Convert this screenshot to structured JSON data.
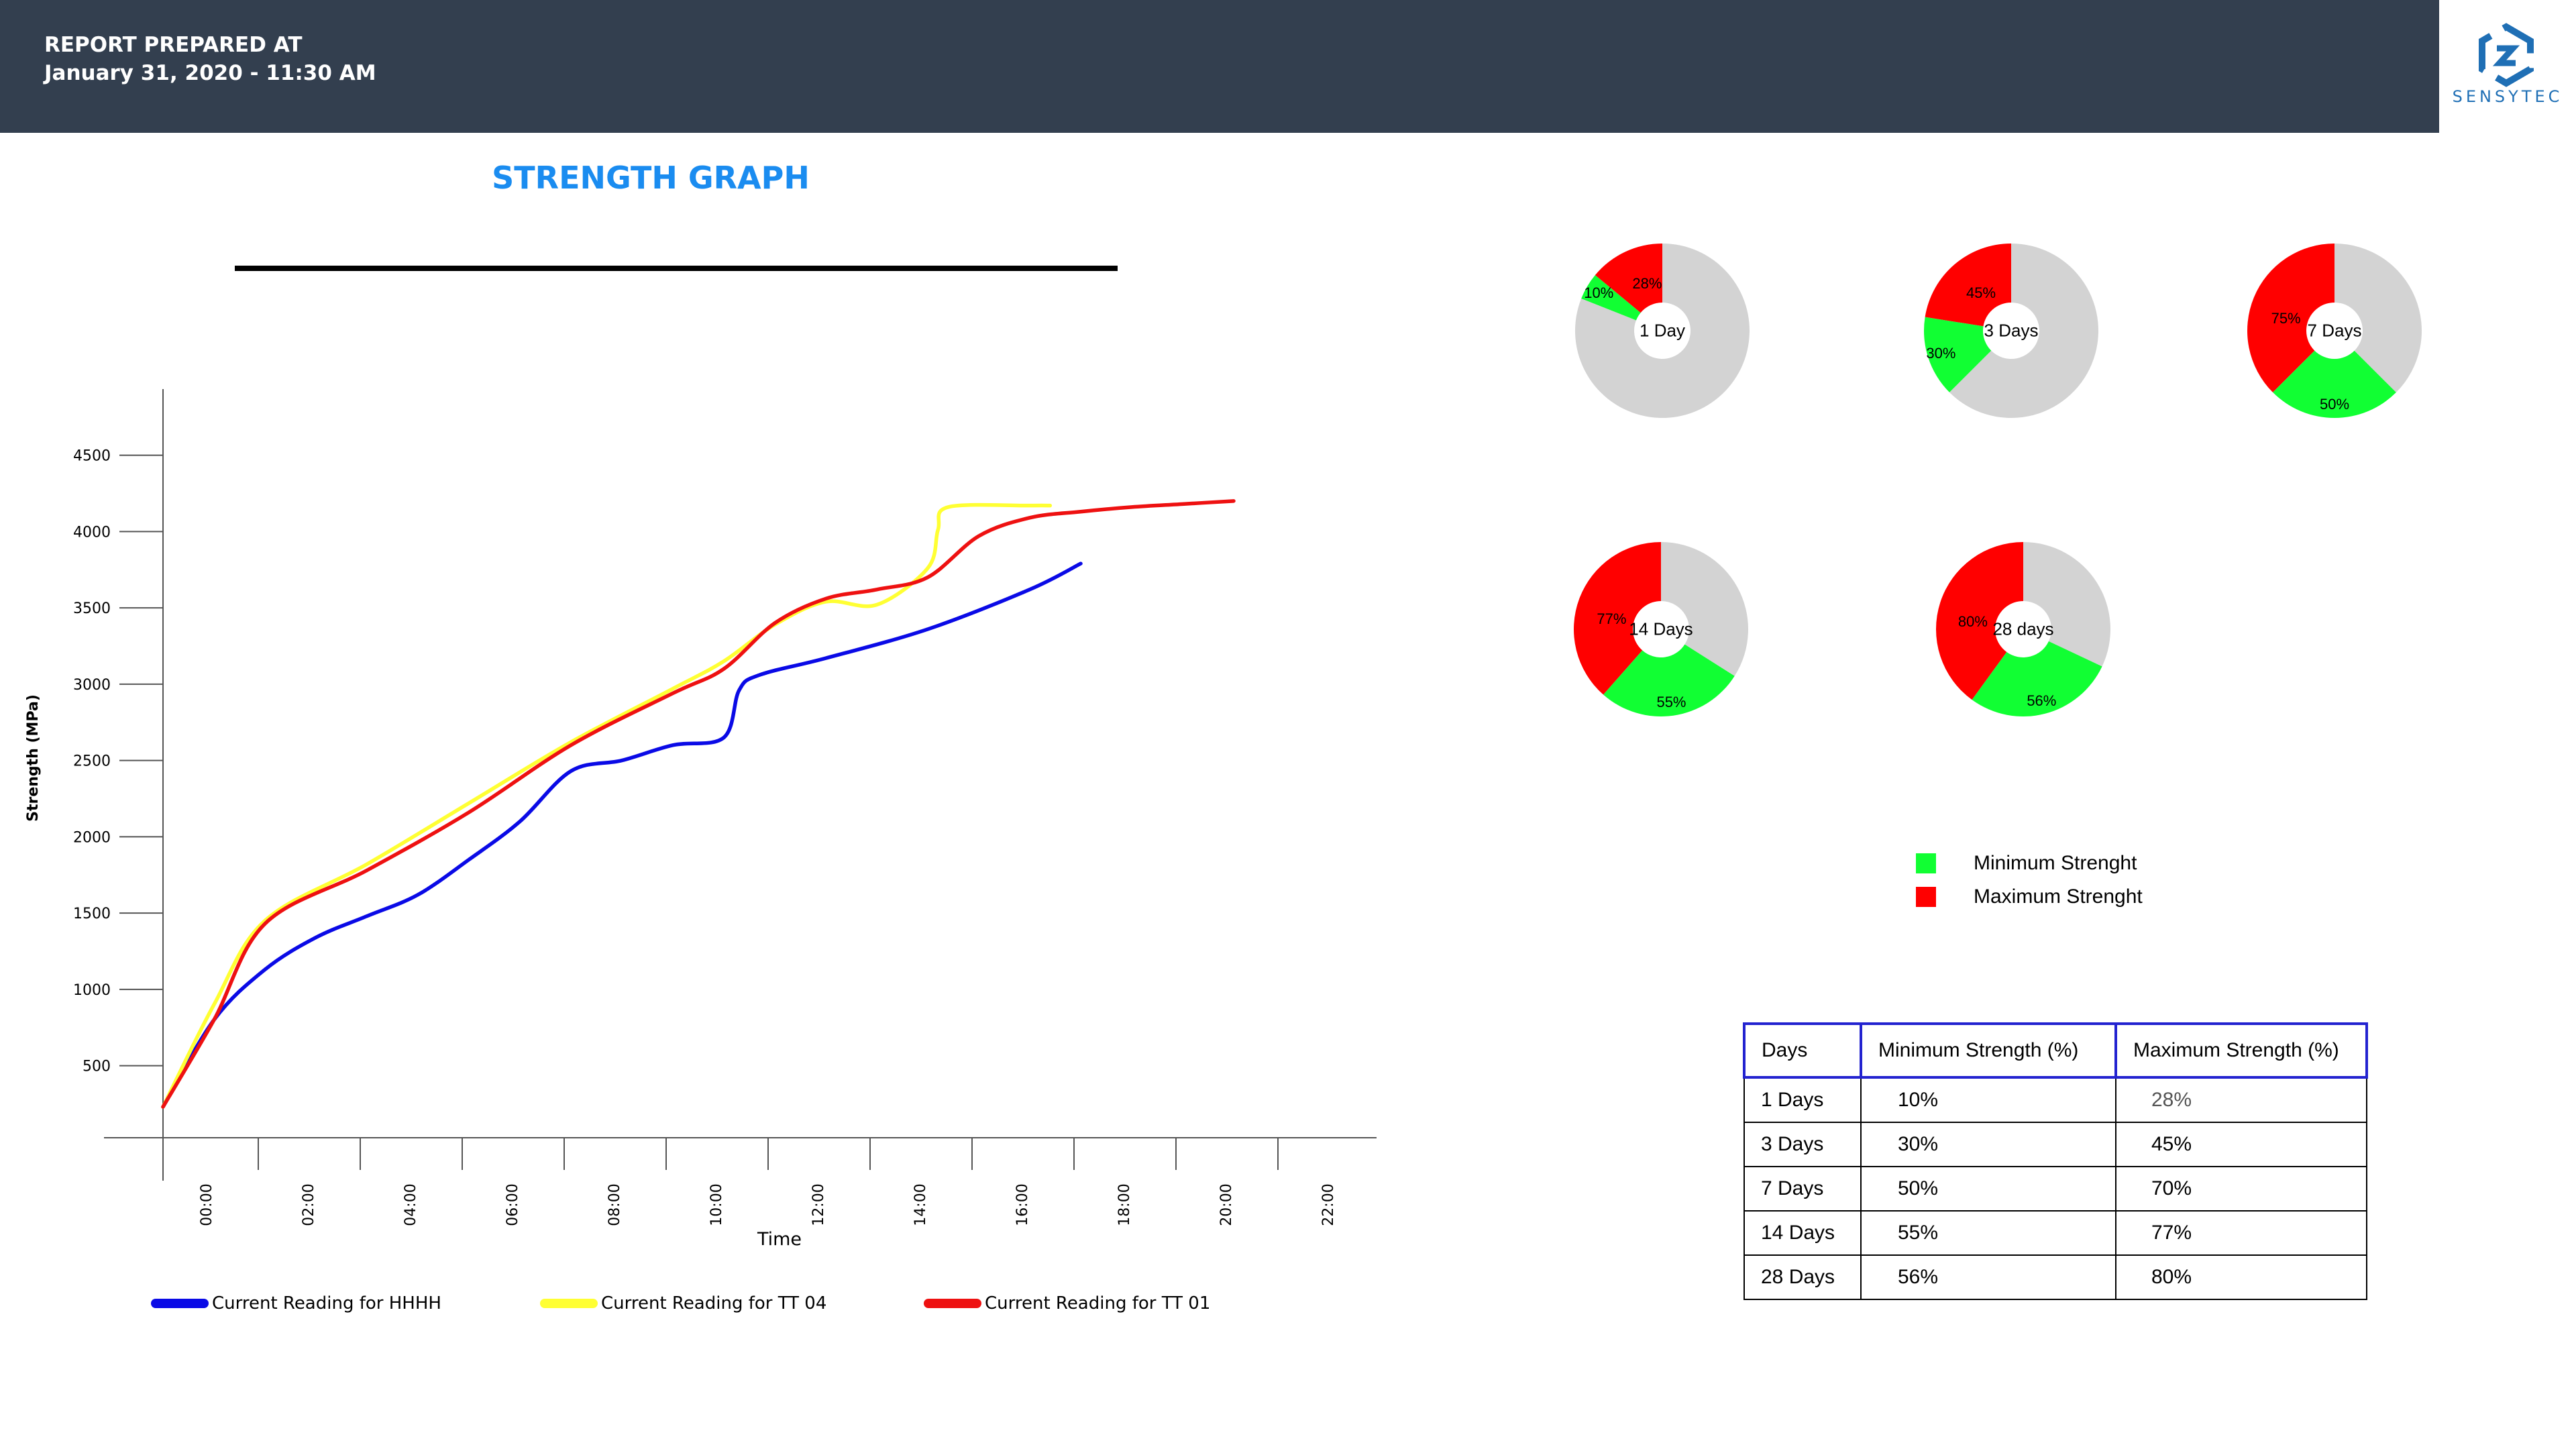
{
  "header": {
    "line1": "REPORT PREPARED AT",
    "line2": "January 31, 2020 - 11:30 AM",
    "bg": "#333f4f"
  },
  "logo": {
    "text": "SENSYTEC",
    "icon": "sensytec-logo-icon"
  },
  "graph_title": "STRENGTH GRAPH",
  "chart_data": [
    {
      "type": "line",
      "title": "STRENGTH GRAPH",
      "xlabel": "Time",
      "ylabel": "Strength (MPa)",
      "x_ticks": [
        "00:00",
        "02:00",
        "04:00",
        "06:00",
        "08:00",
        "10:00",
        "12:00",
        "14:00",
        "16:00",
        "18:00",
        "20:00",
        "22:00"
      ],
      "y_ticks": [
        500,
        1000,
        1500,
        2000,
        2500,
        3000,
        3500,
        4000,
        4500
      ],
      "xlim": [
        0,
        22
      ],
      "ylim": [
        0,
        4800
      ],
      "legend_position": "bottom",
      "series": [
        {
          "name": "Current Reading for HHHH",
          "color": "#0a0ae6",
          "x": [
            0,
            1,
            2,
            3,
            4,
            5,
            6,
            7,
            8,
            9,
            10,
            11,
            11.3,
            11.7,
            13,
            15,
            17,
            18
          ],
          "y": [
            230,
            800,
            1130,
            1340,
            1480,
            1620,
            1850,
            2100,
            2430,
            2500,
            2600,
            2650,
            2960,
            3060,
            3170,
            3360,
            3620,
            3790
          ]
        },
        {
          "name": "Current Reading for TT 04",
          "color": "#ffff33",
          "x": [
            0,
            1,
            2,
            4,
            6,
            8,
            10,
            11,
            12,
            13,
            14,
            15,
            15.2,
            15.4,
            17,
            17.4
          ],
          "y": [
            230,
            900,
            1450,
            1820,
            2220,
            2620,
            2970,
            3150,
            3390,
            3540,
            3520,
            3760,
            4010,
            4160,
            4170,
            4170
          ]
        },
        {
          "name": "Current Reading for TT 01",
          "color": "#ee1111",
          "x": [
            0,
            1,
            2,
            4,
            6,
            8,
            10,
            11,
            12,
            13,
            14,
            15,
            16,
            17,
            18,
            19,
            20,
            21
          ],
          "y": [
            230,
            800,
            1430,
            1780,
            2160,
            2600,
            2940,
            3100,
            3400,
            3560,
            3620,
            3700,
            3970,
            4090,
            4130,
            4160,
            4180,
            4200
          ]
        }
      ]
    },
    {
      "type": "pie",
      "items": [
        {
          "label": "1 Day",
          "min_pct": 10,
          "max_pct": 28,
          "min_text": "10%",
          "max_text": "28%"
        },
        {
          "label": "3 Days",
          "min_pct": 30,
          "max_pct": 45,
          "min_text": "30%",
          "max_text": "45%"
        },
        {
          "label": "7 Days",
          "min_pct": 50,
          "max_pct": 75,
          "min_text": "50%",
          "max_text": "75%"
        },
        {
          "label": "14 Days",
          "min_pct": 55,
          "max_pct": 77,
          "min_text": "55%",
          "max_text": "77%"
        },
        {
          "label": "28 days",
          "min_pct": 56,
          "max_pct": 80,
          "min_text": "56%",
          "max_text": "80%"
        }
      ],
      "colors": {
        "min": "#11ff33",
        "max": "#ff0000",
        "rest": "#d3d3d3",
        "hole": "#ffffff"
      }
    }
  ],
  "pie_legend": [
    {
      "label": "Minimum Strenght",
      "color": "#11ff33"
    },
    {
      "label": "Maximum Strenght",
      "color": "#ff0000"
    }
  ],
  "table": {
    "headers": [
      "Days",
      "Minimum Strength (%)",
      "Maximum Strength (%)"
    ],
    "rows": [
      [
        "1 Days",
        "10%",
        "28%"
      ],
      [
        "3 Days",
        "30%",
        "45%"
      ],
      [
        "7 Days",
        "50%",
        "70%"
      ],
      [
        "14 Days",
        "55%",
        "77%"
      ],
      [
        "28 Days",
        "56%",
        "80%"
      ]
    ]
  }
}
